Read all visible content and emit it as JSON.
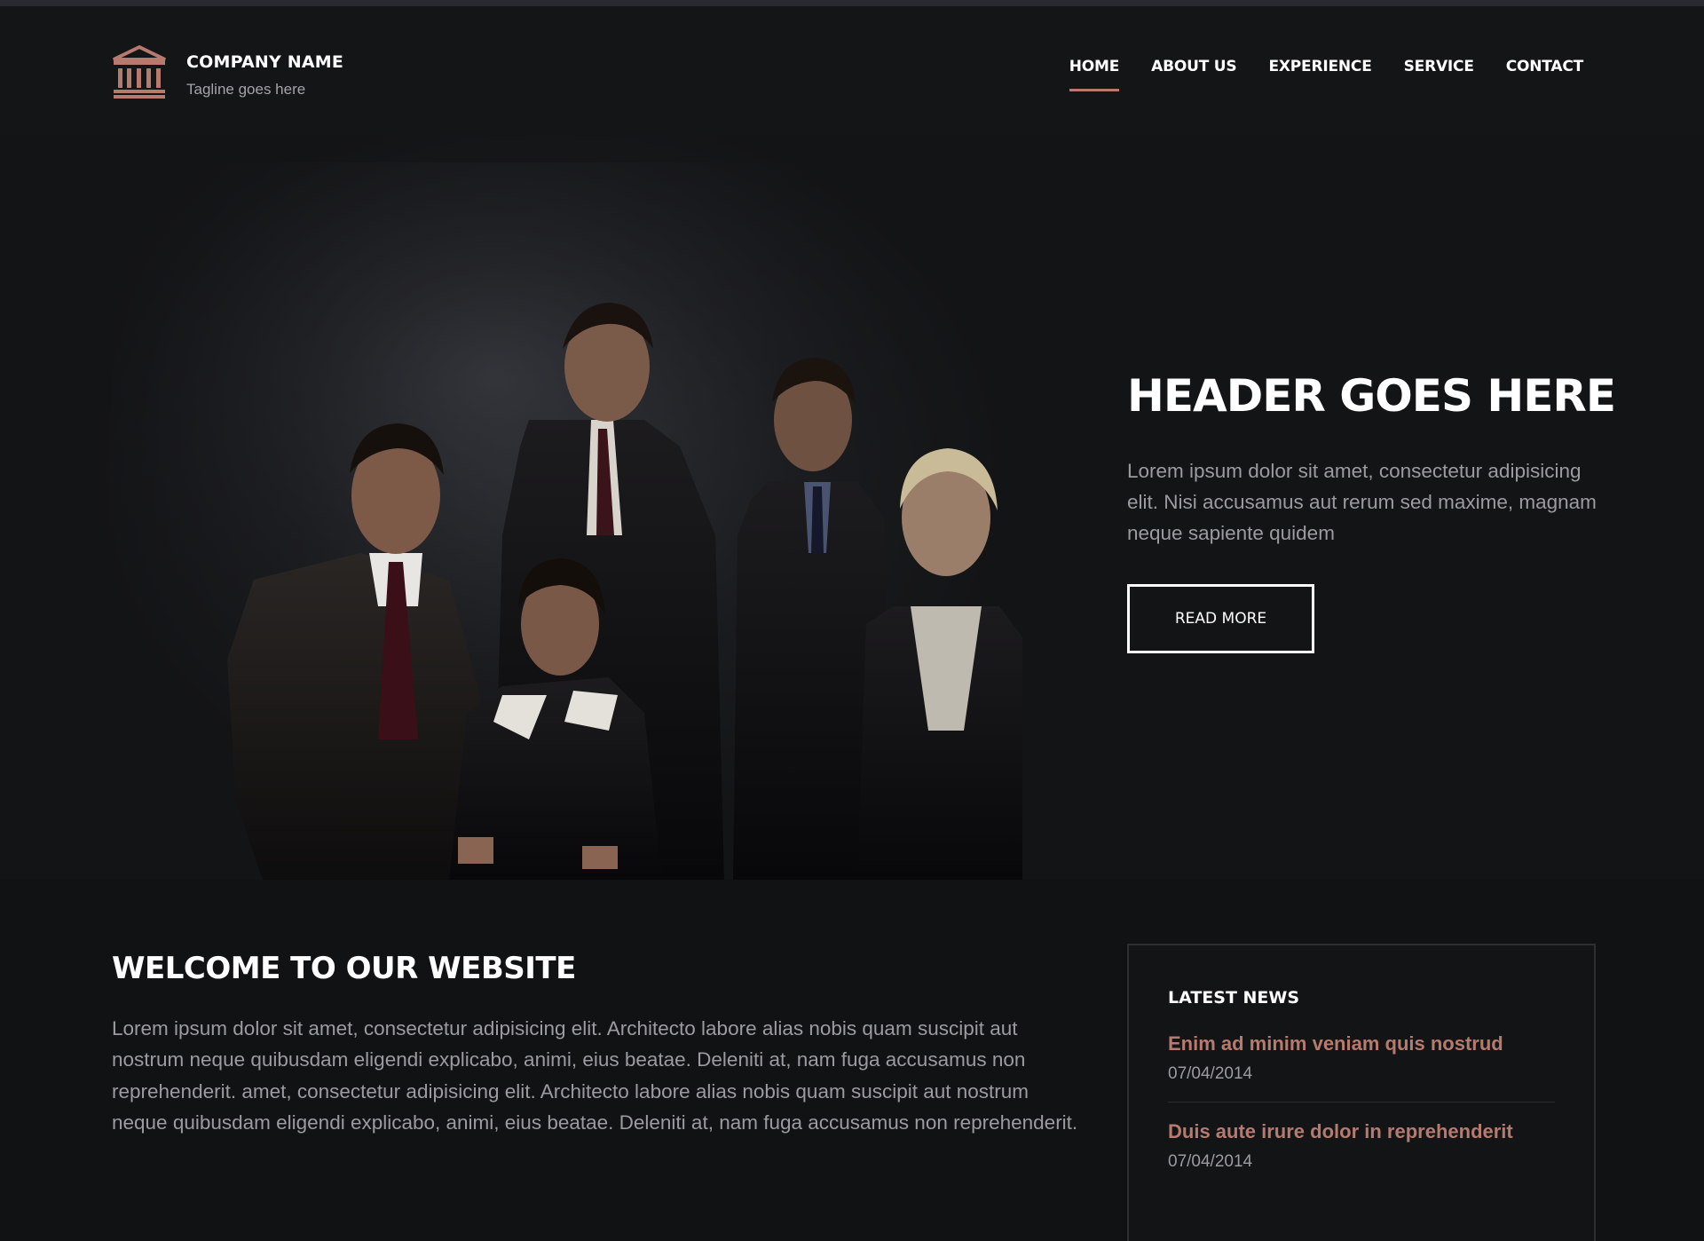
{
  "header": {
    "company_name": "COMPANY NAME",
    "tagline": "Tagline goes here",
    "logo_icon": "bank-building-icon",
    "nav": [
      {
        "label": "HOME",
        "active": true
      },
      {
        "label": "ABOUT US",
        "active": false
      },
      {
        "label": "EXPERIENCE",
        "active": false
      },
      {
        "label": "SERVICE",
        "active": false
      },
      {
        "label": "CONTACT",
        "active": false
      }
    ]
  },
  "hero": {
    "title": "HEADER GOES HERE",
    "text": "Lorem ipsum dolor sit amet, consectetur adipisicing elit. Nisi accusamus aut rerum sed maxime, magnam neque sapiente quidem",
    "button_label": "READ MORE",
    "photo_description_icon": "team-photo"
  },
  "welcome": {
    "title": "WELCOME TO OUR WEBSITE",
    "text": "Lorem ipsum dolor sit amet, consectetur adipisicing elit. Architecto labore alias nobis quam suscipit aut nostrum neque quibusdam eligendi explicabo, animi, eius beatae. Deleniti at, nam fuga accusamus non reprehenderit. amet, consectetur adipisicing elit. Architecto labore alias nobis quam suscipit aut nostrum neque quibusdam eligendi explicabo, animi, eius beatae. Deleniti at, nam fuga accusamus non reprehenderit."
  },
  "news": {
    "title": "LATEST NEWS",
    "items": [
      {
        "headline": "Enim ad minim veniam quis nostrud",
        "date": "07/04/2014"
      },
      {
        "headline": "Duis aute irure dolor in reprehenderit",
        "date": "07/04/2014"
      }
    ]
  },
  "colors": {
    "accent": "#b67a6e",
    "background": "#111214",
    "header_bg": "#141517",
    "muted_text": "#9b9ba0"
  }
}
